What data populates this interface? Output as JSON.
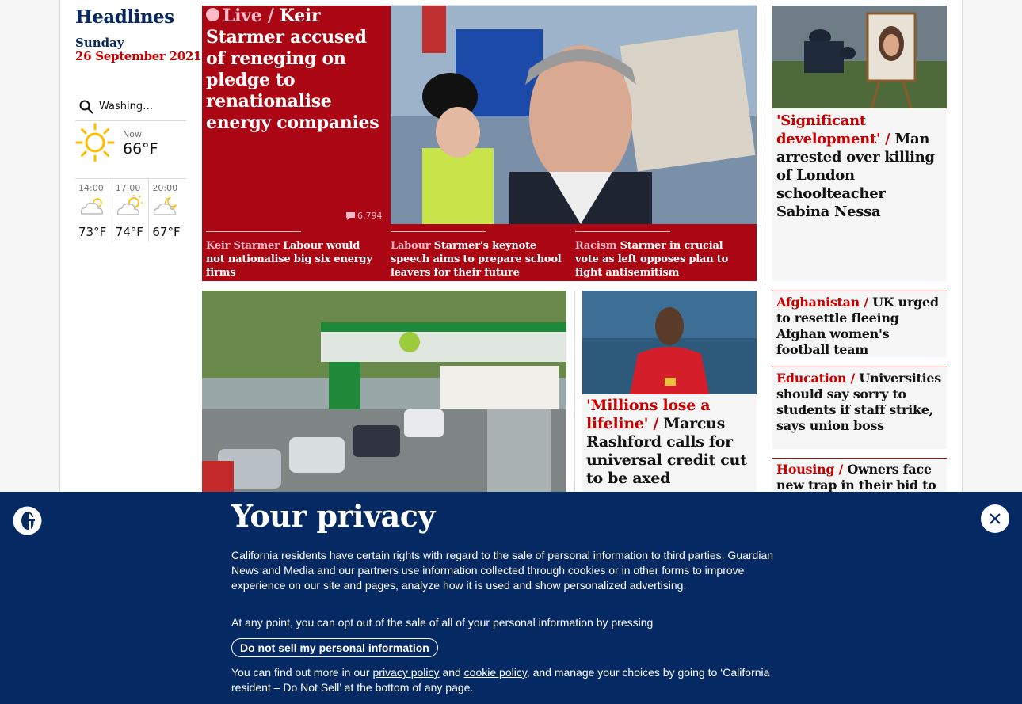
{
  "sidebar": {
    "title": "Headlines",
    "day": "Sunday",
    "date": "26 September 2021"
  },
  "weather": {
    "location": "Washing…",
    "now_label": "Now",
    "now_temp": "66°F",
    "now_icon": "sun-icon",
    "forecast": [
      {
        "time": "14:00",
        "temp": "73°F",
        "icon": "cloud-icon"
      },
      {
        "time": "17:00",
        "temp": "74°F",
        "icon": "sun-cloud-icon"
      },
      {
        "time": "20:00",
        "temp": "67°F",
        "icon": "moon-cloud-icon"
      }
    ]
  },
  "lead": {
    "kicker": "Live",
    "headline": "Keir Starmer accused of reneging on pledge to renationalise energy companies",
    "comments": "6,794",
    "sublinks": [
      {
        "kicker": "Keir Starmer",
        "text": "Labour would not nationalise big six energy firms"
      },
      {
        "kicker": "Labour",
        "text": "Starmer's keynote speech aims to prepare school leavers for their future"
      },
      {
        "kicker": "Racism",
        "text": "Starmer in crucial vote as left opposes plan to fight antisemitism"
      }
    ]
  },
  "right_top": {
    "kicker": "'Significant development'",
    "headline": "Man arrested over killing of London schoolteacher Sabina Nessa"
  },
  "rashford": {
    "kicker": "'Millions lose a lifeline'",
    "headline": "Marcus Rashford calls for universal credit cut to be axed"
  },
  "small_stories": [
    {
      "kicker": "Afghanistan",
      "headline": "UK urged to resettle fleeing Afghan women's football team"
    },
    {
      "kicker": "Education",
      "headline": "Universities should say sorry to students if staff strike, says union boss"
    },
    {
      "kicker": "Housing",
      "headline": "Owners face new trap in their bid to sell"
    }
  ],
  "privacy": {
    "title": "Your privacy",
    "body": "California residents have certain rights with regard to the sale of personal information to third parties. Guardian News and Media and our partners use information collected through cookies or in other forms to improve experience on our site and pages, analyze how it is used and show personalized advertising.",
    "optout": "At any point, you can opt out of the sale of all of your personal information by pressing",
    "button": "Do not sell my personal information",
    "find_prefix": "You can find out more in our",
    "privacy_link": "privacy policy",
    "and": "and",
    "cookie_link": "cookie policy",
    "find_suffix": ", and manage your choices by going to ‘California resident – Do Not Sell’ at the bottom of any page."
  },
  "colors": {
    "brand_blue": "#052962",
    "lead_red": "#ab0613",
    "kicker_red": "#c70000",
    "live_pink": "#ffbac8"
  }
}
